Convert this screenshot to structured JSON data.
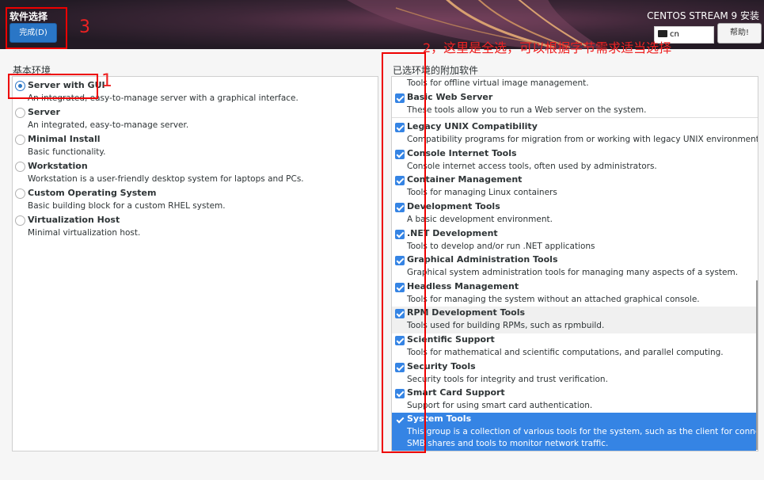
{
  "header": {
    "spoke_title": "软件选择",
    "done_label": "完成(D)",
    "product_title": "CENTOS STREAM 9 安装",
    "keyboard_layout": "cn",
    "help_label": "帮助!"
  },
  "base_env": {
    "title": "基本环境",
    "items": [
      {
        "name": "Server with GUI",
        "desc": "An integrated, easy-to-manage server with a graphical interface.",
        "selected": true
      },
      {
        "name": "Server",
        "desc": "An integrated, easy-to-manage server."
      },
      {
        "name": "Minimal Install",
        "desc": "Basic functionality."
      },
      {
        "name": "Workstation",
        "desc": "Workstation is a user-friendly desktop system for laptops and PCs."
      },
      {
        "name": "Custom Operating System",
        "desc": "Basic building block for a custom RHEL system."
      },
      {
        "name": "Virtualization Host",
        "desc": "Minimal virtualization host."
      }
    ]
  },
  "addons": {
    "title": "已选环境的附加软件",
    "partial_top": "Tools for offline virtual image management.",
    "items": [
      {
        "name": "Basic Web Server",
        "desc": "These tools allow you to run a Web server on the system."
      },
      {
        "name": "Legacy UNIX Compatibility",
        "desc": "Compatibility programs for migration from or working with legacy UNIX environments."
      },
      {
        "name": "Console Internet Tools",
        "desc": "Console internet access tools, often used by administrators."
      },
      {
        "name": "Container Management",
        "desc": "Tools for managing Linux containers"
      },
      {
        "name": "Development Tools",
        "desc": "A basic development environment."
      },
      {
        "name": ".NET Development",
        "desc": "Tools to develop and/or run .NET applications"
      },
      {
        "name": "Graphical Administration Tools",
        "desc": "Graphical system administration tools for managing many aspects of a system."
      },
      {
        "name": "Headless Management",
        "desc": "Tools for managing the system without an attached graphical console."
      },
      {
        "name": "RPM Development Tools",
        "desc": "Tools used for building RPMs, such as rpmbuild."
      },
      {
        "name": "Scientific Support",
        "desc": "Tools for mathematical and scientific computations, and parallel computing."
      },
      {
        "name": "Security Tools",
        "desc": "Security tools for integrity and trust verification."
      },
      {
        "name": "Smart Card Support",
        "desc": "Support for using smart card authentication."
      },
      {
        "name": "System Tools",
        "desc": "This group is a collection of various tools for the system, such as the client for connecting to",
        "desc2": "SMB shares and tools to monitor network traffic."
      }
    ]
  },
  "annotations": {
    "n1": "1",
    "n2": "2，这里是全选，可以根据字节需求适当选择",
    "n3": "3"
  },
  "colors": {
    "accent": "#3584e4",
    "annotation": "#e00000",
    "done_button": "#2a76c6"
  }
}
